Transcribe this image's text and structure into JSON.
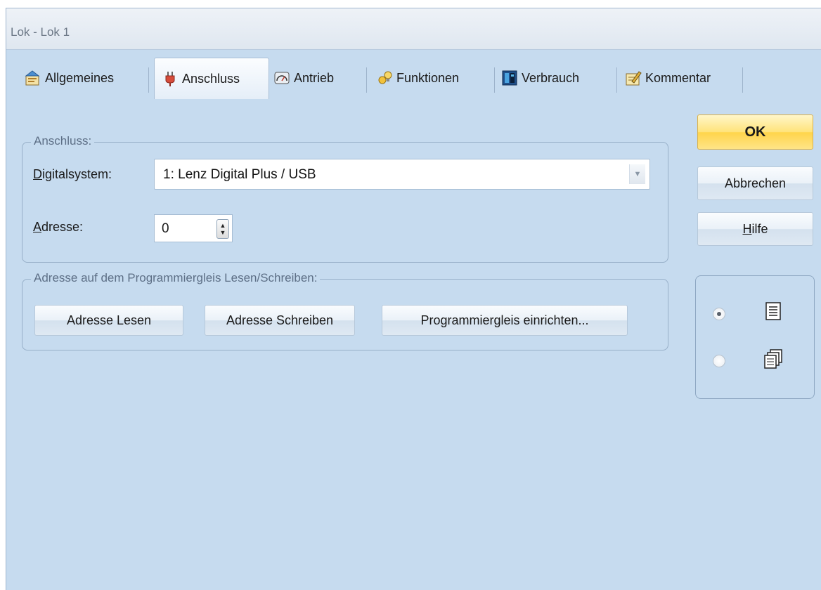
{
  "window": {
    "title": "Lok - Lok 1"
  },
  "tabs": [
    {
      "label": "Allgemeines",
      "icon": "properties-icon",
      "active": false
    },
    {
      "label": "Anschluss",
      "icon": "plug-icon",
      "active": true
    },
    {
      "label": "Antrieb",
      "icon": "gauge-icon",
      "active": false
    },
    {
      "label": "Funktionen",
      "icon": "bulb-icon",
      "active": false
    },
    {
      "label": "Verbrauch",
      "icon": "battery-icon",
      "active": false
    },
    {
      "label": "Kommentar",
      "icon": "note-pencil-icon",
      "active": false
    }
  ],
  "connection": {
    "legend": "Anschluss:",
    "digitalsystem_label": "Digitalsystem:",
    "digitalsystem_value": "1: Lenz Digital Plus / USB",
    "address_label": "Adresse:",
    "address_value": "0"
  },
  "programming": {
    "legend": "Adresse auf dem Programmiergleis Lesen/Schreiben:",
    "read_label": "Adresse Lesen",
    "write_label": "Adresse Schreiben",
    "setup_label": "Programmiergleis einrichten..."
  },
  "actions": {
    "ok_label": "OK",
    "cancel_label": "Abbrechen",
    "help_label": "Hilfe"
  },
  "view_mode": {
    "options": [
      {
        "icon": "single-page-icon",
        "selected": true
      },
      {
        "icon": "multi-page-icon",
        "selected": false
      }
    ]
  },
  "colors": {
    "window_background": "#c6dbef",
    "ok_button": "#ffd44a"
  }
}
